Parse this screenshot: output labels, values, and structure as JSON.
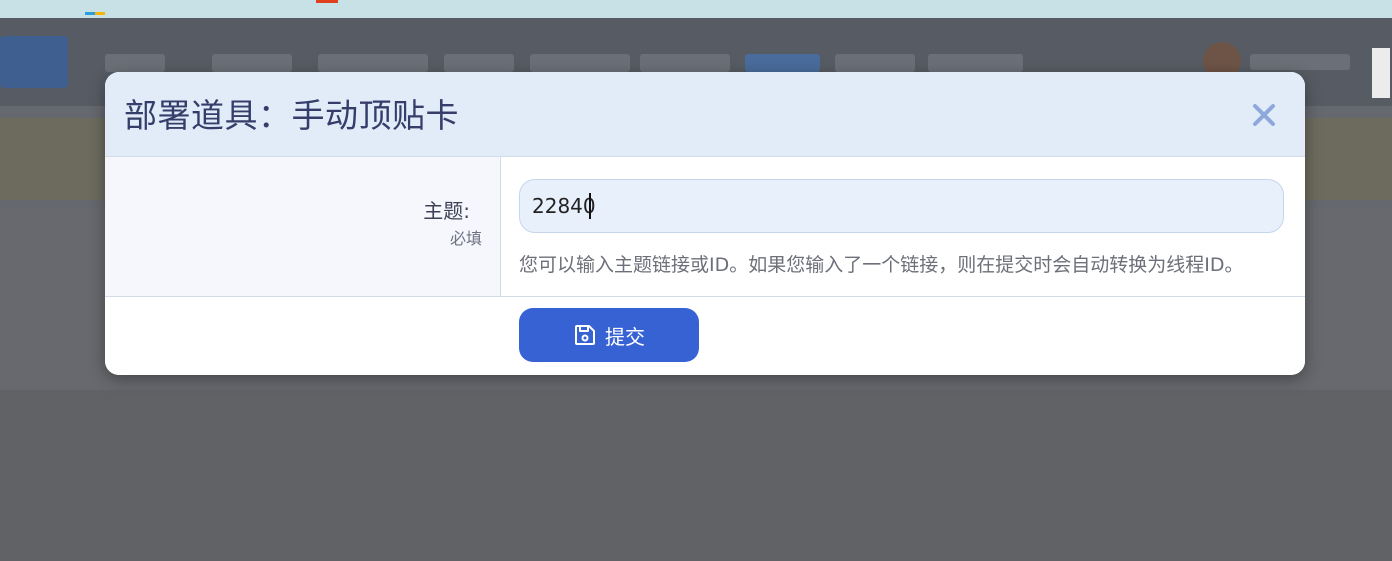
{
  "modal": {
    "title": "部署道具：手动顶贴卡",
    "close_icon": "close-icon",
    "form": {
      "label": "主题:",
      "required_note": "必填",
      "input_value": "22840",
      "help_text": "您可以输入主题链接或ID。如果您输入了一个链接，则在提交时会自动转换为线程ID。"
    },
    "submit": {
      "label": "提交",
      "icon": "save-icon"
    }
  },
  "colors": {
    "header_bg": "#e1ecf8",
    "title": "#353e6a",
    "accent": "#3762d4",
    "input_bg": "#e8f0fc",
    "overlay": "#5e6066"
  }
}
